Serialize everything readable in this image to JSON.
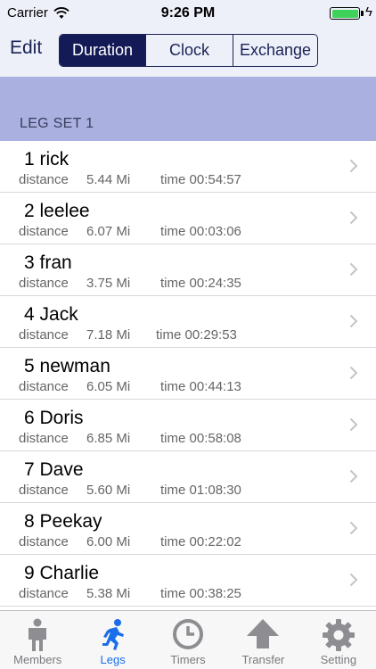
{
  "status": {
    "carrier": "Carrier",
    "time": "9:26 PM"
  },
  "nav": {
    "edit_label": "Edit",
    "segments": [
      "Duration",
      "Clock",
      "Exchange"
    ],
    "selected_segment": "Duration"
  },
  "section": {
    "title": "LEG SET 1"
  },
  "legs": [
    {
      "title": "1 rick",
      "distance_label": "distance",
      "distance": "5.44 Mi",
      "time": "time 00:54:57"
    },
    {
      "title": "2 leelee",
      "distance_label": "distance",
      "distance": "6.07 Mi",
      "time": "time 00:03:06"
    },
    {
      "title": "3 fran",
      "distance_label": "distance",
      "distance": "3.75 Mi",
      "time": "time 00:24:35"
    },
    {
      "title": "4 Jack",
      "distance_label": "distance",
      "distance": "7.18 Mi",
      "time": "time 00:29:53"
    },
    {
      "title": "5 newman",
      "distance_label": "distance",
      "distance": "6.05 Mi",
      "time": "time 00:44:13"
    },
    {
      "title": "6 Doris",
      "distance_label": "distance",
      "distance": "6.85 Mi",
      "time": "time 00:58:08"
    },
    {
      "title": "7 Dave",
      "distance_label": "distance",
      "distance": "5.60 Mi",
      "time": "time 01:08:30"
    },
    {
      "title": "8 Peekay",
      "distance_label": "distance",
      "distance": "6.00 Mi",
      "time": "time 00:22:02"
    },
    {
      "title": "9 Charlie",
      "distance_label": "distance",
      "distance": "5.38 Mi",
      "time": "time 00:38:25"
    }
  ],
  "tabs": [
    {
      "label": "Members",
      "icon": "person-icon"
    },
    {
      "label": "Legs",
      "icon": "runner-icon"
    },
    {
      "label": "Timers",
      "icon": "clock-icon"
    },
    {
      "label": "Transfer",
      "icon": "up-arrow-icon"
    },
    {
      "label": "Setting",
      "icon": "gear-icon"
    }
  ],
  "active_tab": "Legs",
  "colors": {
    "nav_background": "#eef0f9",
    "section_background": "#aab0e0",
    "segment_selected": "#131a55",
    "active_tab": "#1a6ee8",
    "battery": "#3fd25a"
  }
}
